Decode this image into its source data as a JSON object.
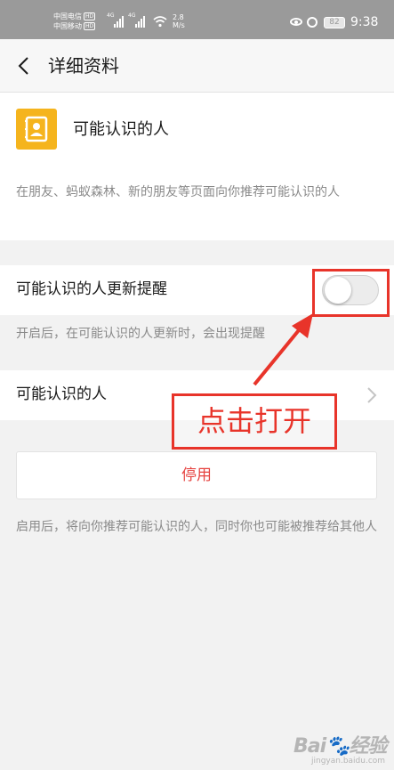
{
  "status_bar": {
    "carrier_1": "中国电信",
    "carrier_2": "中国移动",
    "hd_badge": "HD",
    "network_tag": "4G",
    "speed_value": "2.8",
    "speed_unit": "M/s",
    "battery": "82",
    "time": "9:38",
    "icons": [
      "signal-icon",
      "wifi-icon",
      "eye-icon",
      "alarm-icon",
      "battery-icon"
    ]
  },
  "header": {
    "back_icon": "chevron-left-icon",
    "title": "详细资料"
  },
  "intro": {
    "icon": "contacts-icon",
    "title": "可能认识的人",
    "description": "在朋友、蚂蚁森林、新的朋友等页面向你推荐可能认识的人"
  },
  "reminder": {
    "label": "可能认识的人更新提醒",
    "toggle_on": false,
    "hint": "开启后，在可能认识的人更新时，会出现提醒"
  },
  "people_row": {
    "label": "可能认识的人",
    "chevron_icon": "chevron-right-icon"
  },
  "disable_button": {
    "label": "停用"
  },
  "footer_note": "启用后，将向你推荐可能认识的人，同时你也可能被推荐给其他人",
  "annotation": {
    "callout": "点击打开"
  },
  "colors": {
    "accent_red": "#e64340",
    "annotation_red": "#e8342a",
    "icon_yellow": "#f5b41d",
    "status_bar_bg": "#9a9a9a"
  }
}
